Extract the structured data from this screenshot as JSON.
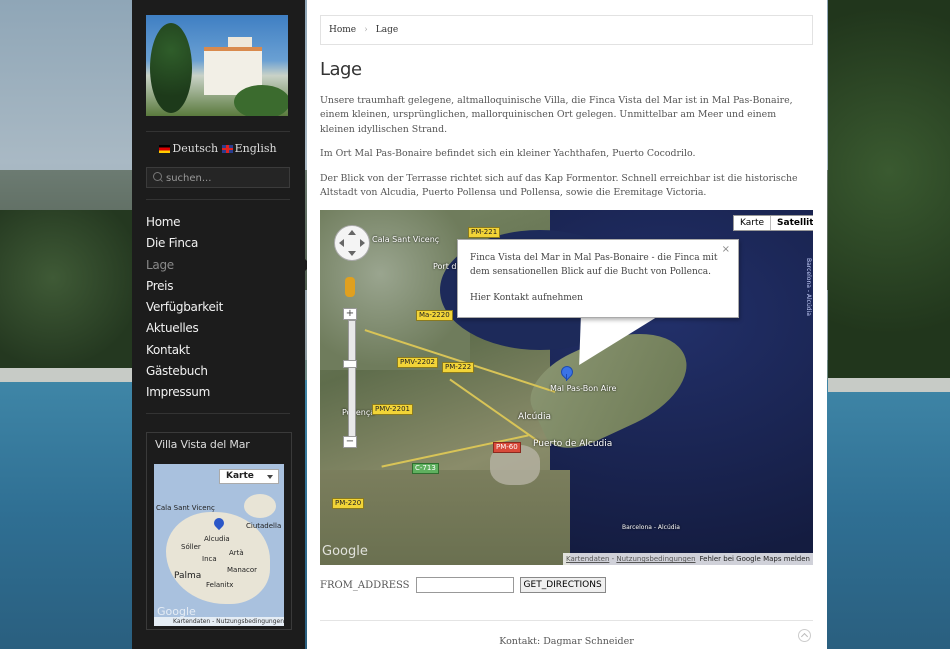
{
  "sidebar": {
    "languages": {
      "german": "Deutsch",
      "english": "English"
    },
    "search": {
      "placeholder": "suchen..."
    },
    "nav": [
      "Home",
      "Die Finca",
      "Lage",
      "Preis",
      "Verfügbarkeit",
      "Aktuelles",
      "Kontakt",
      "Gästebuch",
      "Impressum"
    ],
    "active_nav": "Lage",
    "widget": {
      "title": "Villa Vista del Mar",
      "map_type": "Karte",
      "labels": [
        "Cala Sant Vicenç",
        "Ciutadella",
        "Alcudia",
        "Sóller",
        "Artà",
        "Inca",
        "Manacor",
        "Palma",
        "Felanitx"
      ],
      "google": "Google",
      "terms": "Kartendaten - Nutzungsbedingungen"
    }
  },
  "breadcrumb": {
    "home": "Home",
    "current": "Lage"
  },
  "page": {
    "title": "Lage",
    "paragraphs": [
      "Unsere traumhaft gelegene, altmalloquinische Villa, die Finca Vista del Mar ist in Mal Pas-Bonaire, einem kleinen, ursprünglichen, mallorquinischen Ort gelegen. Unmittelbar am Meer und einem kleinen idyllischen Strand.",
      "Im Ort Mal Pas-Bonaire befindet sich ein kleiner Yachthafen, Puerto Cocodrilo.",
      "Der Blick von der Terrasse richtet sich auf das Kap Formentor. Schnell erreichbar ist die historische Altstadt von Alcudia, Puerto Pollensa und Pollensa, sowie die Eremitage Victoria."
    ]
  },
  "map": {
    "type_buttons": [
      "Karte",
      "Satellit"
    ],
    "selected_type": "Satellit",
    "infowindow": {
      "text": "Finca Vista del Mar in Mal Pas-Bonaire - die Finca mit dem sensationellen Blick auf die Bucht von Pollenca.",
      "link": "Hier Kontakt aufnehmen",
      "close": "×"
    },
    "places": [
      "Cala Sant Vicenç",
      "Port de Pollença",
      "Pollença",
      "Alcúdia",
      "Puerto de Alcudia",
      "Mal Pas-Bon Aire",
      "Barcelona - Alcúdia"
    ],
    "roads": [
      "PM-221",
      "Ma-2220",
      "PMV-2202",
      "PM-222",
      "PMV-2201",
      "PM-220",
      "PM-60",
      "C-713",
      "PM-220"
    ],
    "google": "Google",
    "terms": {
      "data": "Kartendaten",
      "usage": "Nutzungsbedingungen",
      "report": "Fehler bei Google Maps melden"
    },
    "zoom_in": "+",
    "zoom_out": "−"
  },
  "directions": {
    "label": "FROM_ADDRESS",
    "input_value": "",
    "button": "GET_DIRECTIONS"
  },
  "footer": {
    "contact": "Kontakt: Dagmar Schneider"
  }
}
